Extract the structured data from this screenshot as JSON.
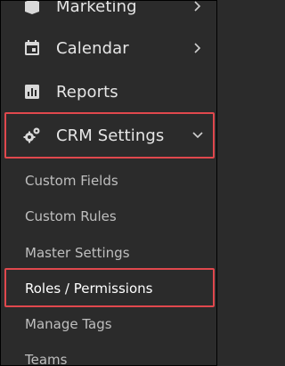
{
  "menu": {
    "marketing": {
      "label": "Marketing",
      "icon": "marketing-icon"
    },
    "calendar": {
      "label": "Calendar",
      "icon": "calendar-icon"
    },
    "reports": {
      "label": "Reports",
      "icon": "reports-icon"
    },
    "crm_settings": {
      "label": "CRM Settings",
      "icon": "gears-icon",
      "expanded": true
    }
  },
  "submenu": {
    "custom_fields": "Custom Fields",
    "custom_rules": "Custom Rules",
    "master_settings": "Master Settings",
    "roles_permissions": "Roles / Permissions",
    "manage_tags": "Manage Tags",
    "teams": "Teams"
  },
  "colors": {
    "background": "#2b2b2b",
    "highlight": "#e0484d",
    "text": "#e6e6e6",
    "subtext": "#bfbfbf"
  }
}
